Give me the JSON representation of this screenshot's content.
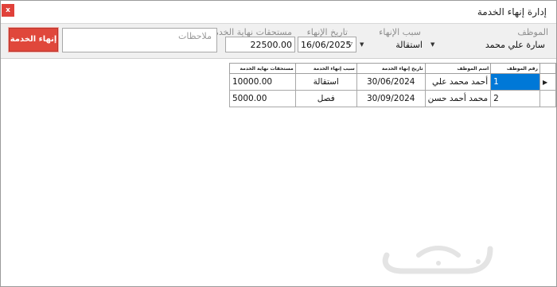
{
  "window": {
    "title": "إدارة إنهاء الخدمة",
    "close_label": "x"
  },
  "form": {
    "employee_label": "الموظف",
    "employee_value": "سارة علي محمد",
    "reason_label": "سبب الإنهاء",
    "reason_value": "استقالة",
    "date_label": "تاريخ الإنهاء",
    "date_value": "16/06/2025",
    "benefits_label": "مستحقات نهاية الخدمة",
    "benefits_value": "22500.00",
    "notes_label": "ملاحظات",
    "end_service_button": "إنهاء الخدمة"
  },
  "table": {
    "headers": {
      "emp_no": "رقم الموظف",
      "emp_name": "اسم الموظف",
      "end_date": "تاريخ إنهاء الخدمة",
      "reason": "سبب إنهاء الخدمة",
      "benefits": "مستحقات نهاية الخدمة"
    },
    "current_row_marker": "▶",
    "rows": [
      {
        "emp_no": "1",
        "emp_name": "أحمد محمد علي",
        "end_date": "30/06/2024",
        "reason": "استقالة",
        "benefits": "10000.00"
      },
      {
        "emp_no": "2",
        "emp_name": "محمد أحمد حسن",
        "end_date": "30/09/2024",
        "reason": "فصل",
        "benefits": "5000.00"
      }
    ]
  },
  "watermark": {
    "text": "حراج"
  }
}
